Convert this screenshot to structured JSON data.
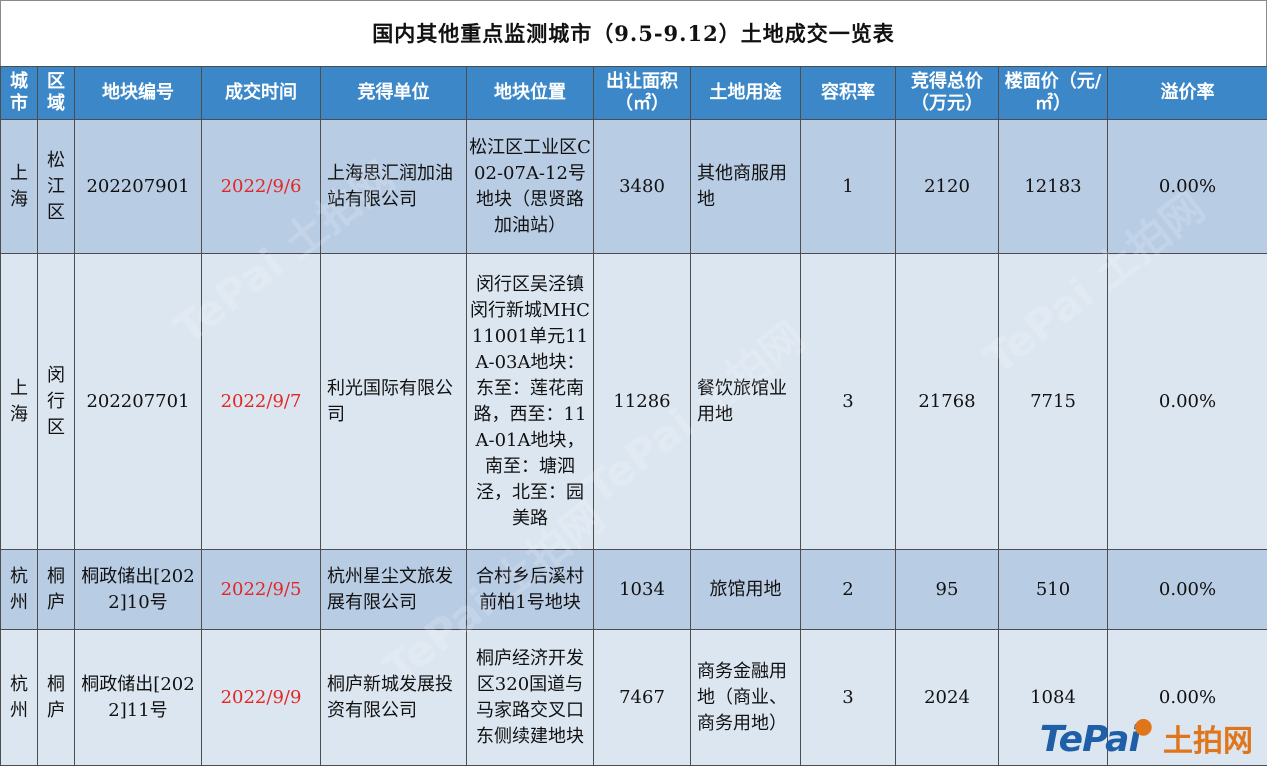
{
  "title": "国内其他重点监测城市（9.5-9.12）土地成交一览表",
  "headers": [
    "城市",
    "区域",
    "地块编号",
    "成交时间",
    "竞得单位",
    "地块位置",
    "出让面积（㎡）",
    "土地用途",
    "容积率",
    "竞得总价（万元）",
    "楼面价（元/㎡）",
    "溢价率"
  ],
  "rows": [
    {
      "city": "上海",
      "district": "松江区",
      "parcel_id": "202207901",
      "date": "2022/9/6",
      "winner": "上海思汇润加油站有限公司",
      "location": "松江区工业区C02-07A-12号地块（思贤路加油站）",
      "area": "3480",
      "use": "其他商服用地",
      "far": "1",
      "total_price": "2120",
      "floor_price": "12183",
      "premium": "0.00%"
    },
    {
      "city": "上海",
      "district": "闵行区",
      "parcel_id": "202207701",
      "date": "2022/9/7",
      "winner": "利光国际有限公司",
      "location": "闵行区吴泾镇闵行新城MHC11001单元11A-03A地块：东至：莲花南路，西至：11A-01A地块，南至：塘泗泾，北至：园美路",
      "area": "11286",
      "use": "餐饮旅馆业用地",
      "far": "3",
      "total_price": "21768",
      "floor_price": "7715",
      "premium": "0.00%"
    },
    {
      "city": "杭州",
      "district": "桐庐",
      "parcel_id": "桐政储出[2022]10号",
      "date": "2022/9/5",
      "winner": "杭州星尘文旅发展有限公司",
      "location": "合村乡后溪村前柏1号地块",
      "area": "1034",
      "use": "旅馆用地",
      "far": "2",
      "total_price": "95",
      "floor_price": "510",
      "premium": "0.00%"
    },
    {
      "city": "杭州",
      "district": "桐庐",
      "parcel_id": "桐政储出[2022]11号",
      "date": "2022/9/9",
      "winner": "桐庐新城发展投资有限公司",
      "location": "桐庐经济开发区320国道与马家路交叉口东侧续建地块",
      "area": "7467",
      "use": "商务金融用地（商业、商务用地）",
      "far": "3",
      "total_price": "2024",
      "floor_price": "1084",
      "premium": "0.00%"
    }
  ],
  "logo": {
    "en": "TePai",
    "cn": "土拍网"
  },
  "watermark_text": "TePai 土拍网",
  "colors": {
    "header_bg": "#3b87c8",
    "row_odd": "#b8cce4",
    "row_even": "#dce6f1",
    "date": "#e32626"
  }
}
